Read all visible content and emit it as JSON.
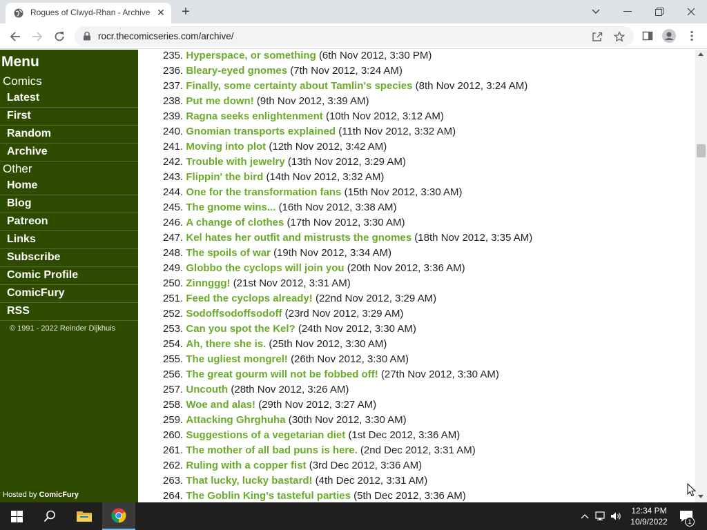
{
  "browser": {
    "tab_title": "Rogues of Clwyd-Rhan - Archive",
    "url": "rocr.thecomicseries.com/archive/"
  },
  "sidebar": {
    "menu_title": "Menu",
    "comics_heading": "Comics",
    "comics_items": [
      "Latest",
      "First",
      "Random",
      "Archive"
    ],
    "other_heading": "Other",
    "other_items": [
      "Home",
      "Blog",
      "Patreon",
      "Links",
      "Subscribe",
      "Comic Profile",
      "ComicFury",
      "RSS"
    ],
    "copyright": "© 1991 - 2022 Reinder Dijkhuis",
    "hosted_prefix": "Hosted by ",
    "hosted_link": "ComicFury",
    "colors": {
      "background": "#2f4b00",
      "link_hover": "#a5d86a"
    }
  },
  "archive": {
    "link_color": "#6bab2a",
    "entries": [
      {
        "num": "235.",
        "title": "Hyperspace, or something",
        "date": "(6th Nov 2012, 3:30 PM)"
      },
      {
        "num": "236.",
        "title": "Bleary-eyed gnomes",
        "date": "(7th Nov 2012, 3:24 AM)"
      },
      {
        "num": "237.",
        "title": "Finally, some certainty about Tamlin's species",
        "date": "(8th Nov 2012, 3:24 AM)"
      },
      {
        "num": "238.",
        "title": "Put me down!",
        "date": "(9th Nov 2012, 3:39 AM)"
      },
      {
        "num": "239.",
        "title": "Ragna seeks enlightenment",
        "date": "(10th Nov 2012, 3:12 AM)"
      },
      {
        "num": "240.",
        "title": "Gnomian transports explained",
        "date": "(11th Nov 2012, 3:32 AM)"
      },
      {
        "num": "241.",
        "title": "Moving into plot",
        "date": "(12th Nov 2012, 3:42 AM)"
      },
      {
        "num": "242.",
        "title": "Trouble with jewelry",
        "date": "(13th Nov 2012, 3:29 AM)"
      },
      {
        "num": "243.",
        "title": "Flippin' the bird",
        "date": "(14th Nov 2012, 3:32 AM)"
      },
      {
        "num": "244.",
        "title": "One for the transformation fans",
        "date": "(15th Nov 2012, 3:30 AM)"
      },
      {
        "num": "245.",
        "title": "The gnome wins...",
        "date": "(16th Nov 2012, 3:38 AM)"
      },
      {
        "num": "246.",
        "title": "A change of clothes",
        "date": "(17th Nov 2012, 3:30 AM)"
      },
      {
        "num": "247.",
        "title": "Kel hates her outfit and mistrusts the gnomes",
        "date": "(18th Nov 2012, 3:35 AM)"
      },
      {
        "num": "248.",
        "title": "The spoils of war",
        "date": "(19th Nov 2012, 3:34 AM)"
      },
      {
        "num": "249.",
        "title": "Globbo the cyclops will join you",
        "date": "(20th Nov 2012, 3:36 AM)"
      },
      {
        "num": "250.",
        "title": "Zinnggg!",
        "date": "(21st Nov 2012, 3:31 AM)"
      },
      {
        "num": "251.",
        "title": "Feed the cyclops already!",
        "date": "(22nd Nov 2012, 3:29 AM)"
      },
      {
        "num": "252.",
        "title": "Sodoffsodoffsodoff",
        "date": "(23rd Nov 2012, 3:29 AM)"
      },
      {
        "num": "253.",
        "title": "Can you spot the Kel?",
        "date": "(24th Nov 2012, 3:30 AM)"
      },
      {
        "num": "254.",
        "title": "Ah, there she is.",
        "date": "(25th Nov 2012, 3:30 AM)"
      },
      {
        "num": "255.",
        "title": "The ugliest mongrel!",
        "date": "(26th Nov 2012, 3:30 AM)"
      },
      {
        "num": "256.",
        "title": "The great gourm will not be fobbed off!",
        "date": "(27th Nov 2012, 3:30 AM)"
      },
      {
        "num": "257.",
        "title": "Uncouth",
        "date": "(28th Nov 2012, 3:26 AM)"
      },
      {
        "num": "258.",
        "title": "Woe and alas!",
        "date": "(29th Nov 2012, 3:27 AM)"
      },
      {
        "num": "259.",
        "title": "Attacking Ghrghuha",
        "date": "(30th Nov 2012, 3:30 AM)"
      },
      {
        "num": "260.",
        "title": "Suggestions of a vegetarian diet",
        "date": "(1st Dec 2012, 3:36 AM)"
      },
      {
        "num": "261.",
        "title": "The mother of all bad puns is here.",
        "date": "(2nd Dec 2012, 3:31 AM)"
      },
      {
        "num": "262.",
        "title": "Ruling with a copper fist",
        "date": "(3rd Dec 2012, 3:36 AM)"
      },
      {
        "num": "263.",
        "title": "That lucky, lucky bastard!",
        "date": "(4th Dec 2012, 3:31 AM)"
      },
      {
        "num": "264.",
        "title": "The Goblin King's tasteful parties",
        "date": "(5th Dec 2012, 3:36 AM)"
      }
    ]
  },
  "taskbar": {
    "time": "12:34 PM",
    "date": "10/9/2022",
    "notification_count": "1"
  }
}
